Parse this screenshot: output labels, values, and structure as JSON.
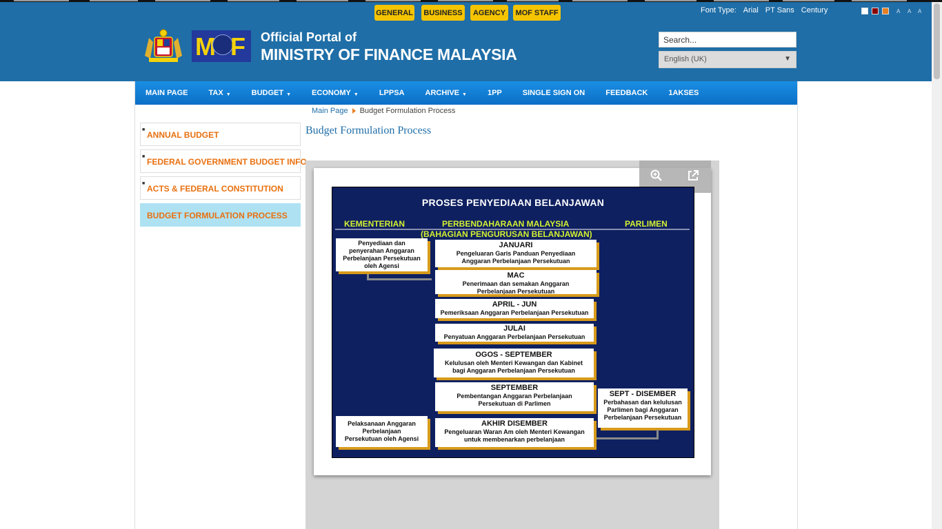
{
  "topbar": {
    "buttons": [
      "GENERAL",
      "BUSINESS",
      "AGENCY",
      "MOF STAFF"
    ],
    "font_type_label": "Font Type:",
    "font_options": [
      "Arial",
      "PT Sans",
      "Century"
    ],
    "theme_colors": [
      "#ffffff",
      "#8b0000",
      "#e67e22"
    ],
    "font_sizes": [
      "A",
      "A",
      "A"
    ]
  },
  "header": {
    "logo_letters": {
      "left": "M",
      "right": "F"
    },
    "title_small": "Official Portal of",
    "title_large": "MINISTRY OF FINANCE MALAYSIA",
    "search_placeholder": "Search...",
    "language": "English (UK)"
  },
  "nav": {
    "items": [
      {
        "label": "MAIN PAGE",
        "dropdown": false
      },
      {
        "label": "TAX",
        "dropdown": true
      },
      {
        "label": "BUDGET",
        "dropdown": true
      },
      {
        "label": "ECONOMY",
        "dropdown": true
      },
      {
        "label": "LPPSA",
        "dropdown": false
      },
      {
        "label": "ARCHIVE",
        "dropdown": true
      },
      {
        "label": "1PP",
        "dropdown": false
      },
      {
        "label": "SINGLE SIGN ON",
        "dropdown": false
      },
      {
        "label": "FEEDBACK",
        "dropdown": false
      },
      {
        "label": "1AKSES",
        "dropdown": false
      }
    ]
  },
  "breadcrumb": {
    "home": "Main Page",
    "current": "Budget Formulation Process"
  },
  "sidebar": {
    "items": [
      {
        "label": "ANNUAL BUDGET",
        "active": false
      },
      {
        "label": "FEDERAL GOVERNMENT BUDGET INFO",
        "active": false
      },
      {
        "label": "ACTS & FEDERAL CONSTITUTION",
        "active": false
      },
      {
        "label": "BUDGET FORMULATION PROCESS",
        "active": true
      }
    ]
  },
  "page": {
    "title": "Budget Formulation Process"
  },
  "viewer": {
    "tools": [
      "zoom-in-icon",
      "open-external-icon"
    ]
  },
  "diagram": {
    "title": "PROSES PENYEDIAAN BELANJAWAN",
    "col_kementerian": "KEMENTERIAN",
    "col_perbendaharaan": "PERBENDAHARAAN MALAYSIA",
    "col_perbendaharaan_sub": "(BAHAGIAN PENGURUSAN BELANJAWAN)",
    "col_parlimen": "PARLIMEN",
    "kementerian_1": [
      "Penyediaan dan",
      "penyerahan Anggaran",
      "Perbelanjaan Persekutuan",
      "oleh Agensi"
    ],
    "kementerian_2": [
      "Pelaksanaan Anggaran",
      "Perbelanjaan",
      "Persekutuan oleh Agensi"
    ],
    "steps": [
      {
        "head": "JANUARI",
        "lines": [
          "Pengeluaran Garis Panduan Penyediaan",
          "Anggaran Perbelanjaan Persekutuan"
        ]
      },
      {
        "head": "MAC",
        "lines": [
          "Penerimaan dan semakan Anggaran",
          "Perbelanjaan  Persekutuan"
        ]
      },
      {
        "head": "APRIL - JUN",
        "lines": [
          "Pemeriksaan  Anggaran Perbelanjaan Persekutuan"
        ]
      },
      {
        "head": "JULAI",
        "lines": [
          "Penyatuan Anggaran Perbelanjaan Persekutuan"
        ]
      },
      {
        "head": "OGOS - SEPTEMBER",
        "lines": [
          "Kelulusan oleh Menteri Kewangan dan Kabinet",
          "bagi Anggaran Perbelanjaan Persekutuan"
        ]
      },
      {
        "head": "SEPTEMBER",
        "lines": [
          "Pembentangan Anggaran Perbelanjaan",
          "Persekutuan di  Parlimen"
        ]
      },
      {
        "head": "AKHIR  DISEMBER",
        "lines": [
          "Pengeluaran Waran Am oleh Menteri Kewangan",
          "untuk membenarkan perbelanjaan"
        ]
      }
    ],
    "parlimen_box": {
      "head": "SEPT - DISEMBER",
      "lines": [
        "Perbahasan dan kelulusan",
        "Parlimen bagi  Anggaran",
        "Perbelanjaan Persekutuan"
      ]
    }
  }
}
